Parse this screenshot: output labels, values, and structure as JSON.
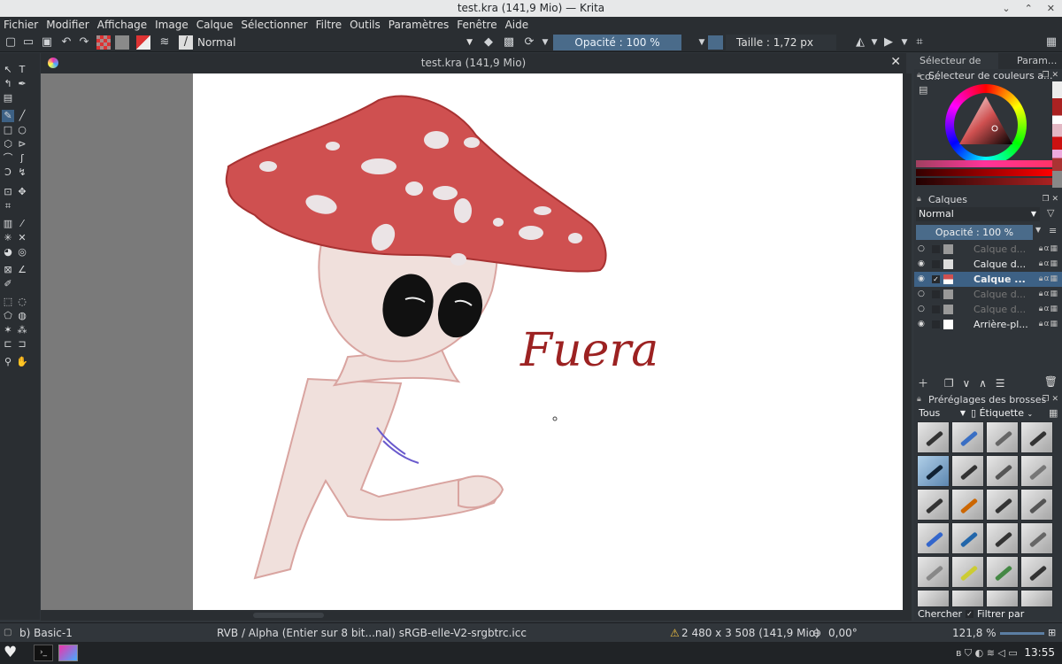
{
  "window": {
    "title": "test.kra (141,9 Mio) — Krita",
    "min": "⌄",
    "max": "⌃",
    "close": "✕"
  },
  "menu": [
    "Fichier",
    "Modifier",
    "Affichage",
    "Image",
    "Calque",
    "Sélectionner",
    "Filtre",
    "Outils",
    "Paramètres",
    "Fenêtre",
    "Aide"
  ],
  "toolbar": {
    "blend_mode": "Normal",
    "opacity": "Opacité : 100 %",
    "size": "Taille :  1,72 px"
  },
  "document": {
    "tab_title": "test.kra (141,9 Mio)",
    "close": "✕",
    "signature_text": "Fuera"
  },
  "dock": {
    "tabs": [
      "Sélecteur de co...",
      "Param..."
    ],
    "color_panel_title": "Sélecteur de couleurs a...",
    "layers_title": "Calques",
    "layers_blend": "Normal",
    "layers_opacity": "Opacité : 100 %",
    "layers": [
      {
        "name": "Calque d...",
        "visible": false,
        "selected": false
      },
      {
        "name": "Calque d...",
        "visible": true,
        "selected": false
      },
      {
        "name": "Calque ...",
        "visible": true,
        "selected": true
      },
      {
        "name": "Calque d...",
        "visible": false,
        "selected": false
      },
      {
        "name": "Calque d...",
        "visible": false,
        "selected": false
      },
      {
        "name": "Arrière-pl...",
        "visible": true,
        "selected": false
      }
    ],
    "brush_title": "Préréglages des brosses",
    "brush_filter": "Tous",
    "brush_tag": "Étiquette",
    "search": "Chercher",
    "filter_by_tag": "Filtrer par étiquette"
  },
  "status": {
    "brush": "b) Basic-1",
    "color_space": "RVB / Alpha (Entier sur 8 bit...nal)  sRGB-elle-V2-srgbtrc.icc",
    "image_size": "2 480 x 3 508 (141,9 Mio)",
    "rotation": "0,00°",
    "zoom": "121,8 %"
  },
  "taskbar": {
    "clock": "13:55"
  },
  "colors": {
    "accent": "#4a6b8a",
    "selection": "#3d6185",
    "mushroom_cap": "#cf5050",
    "body": "#f0e0dc"
  }
}
